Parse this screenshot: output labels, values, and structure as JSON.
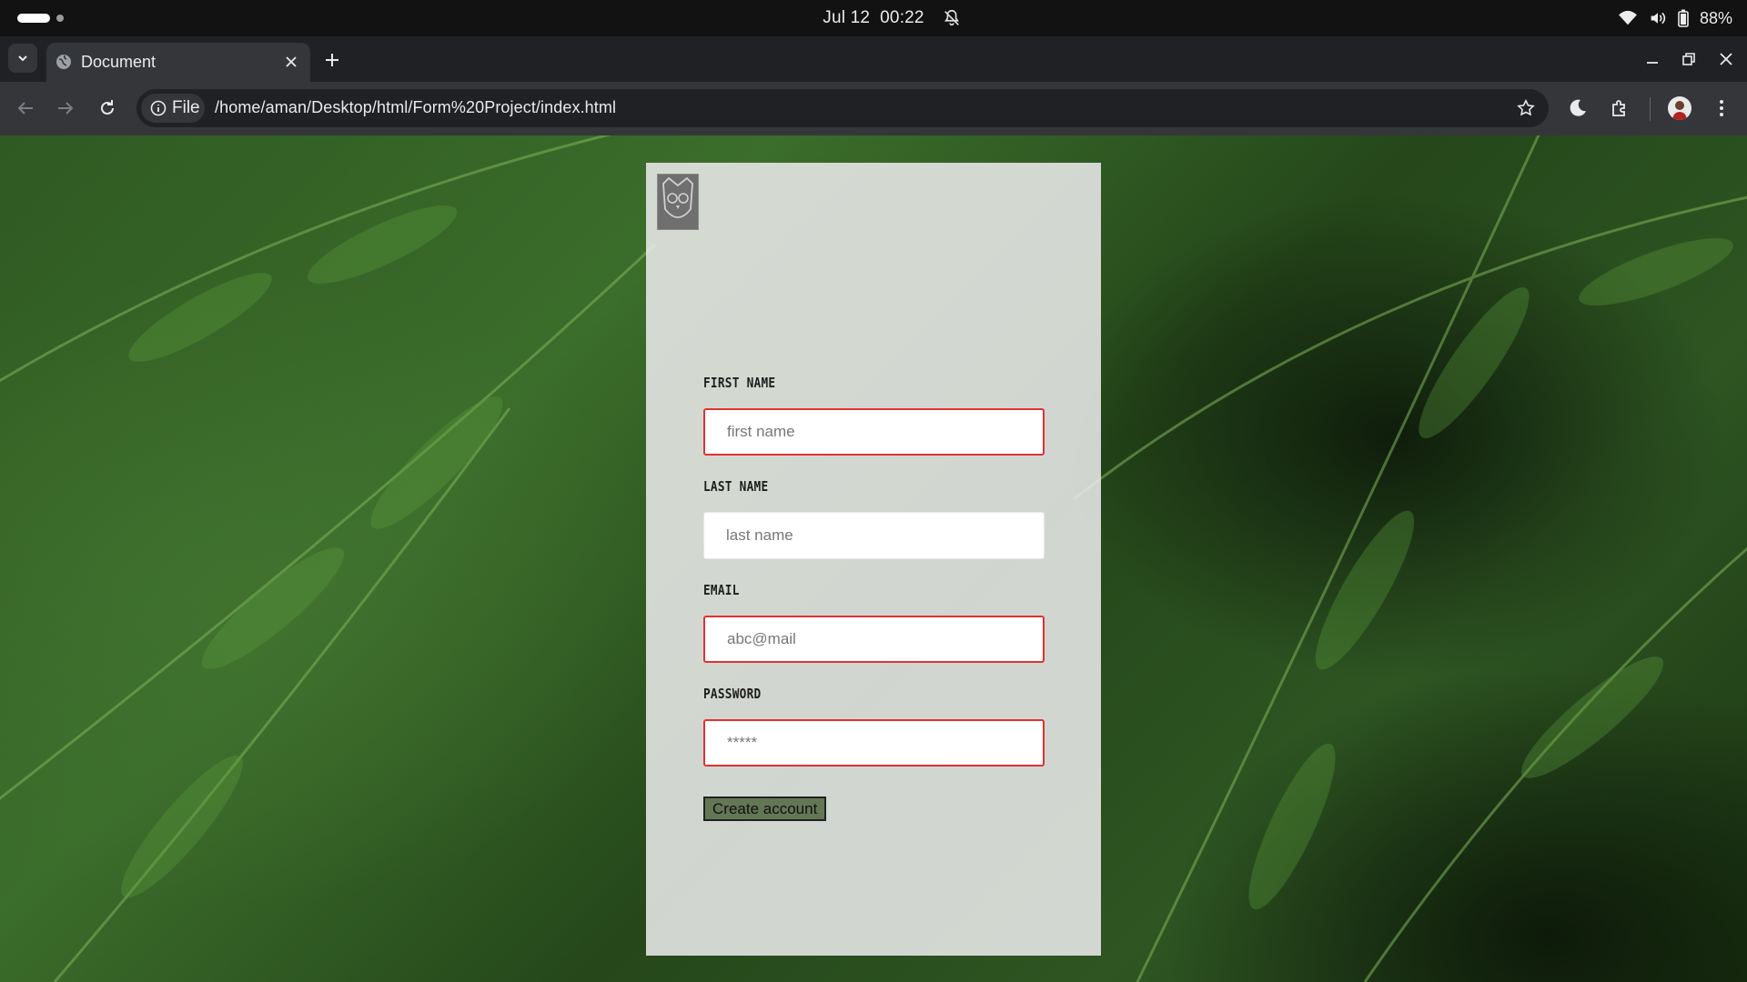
{
  "os": {
    "date": "Jul 12",
    "time": "00:22",
    "battery": "88%"
  },
  "browser": {
    "tab_title": "Document",
    "security_chip": "File",
    "url": "/home/aman/Desktop/html/Form%20Project/index.html"
  },
  "form": {
    "first_name": {
      "label": "FIRST NAME",
      "placeholder": "first name",
      "value": ""
    },
    "last_name": {
      "label": "LAST NAME",
      "placeholder": "last name",
      "value": ""
    },
    "email": {
      "label": "EMAIL",
      "placeholder": "abc@mail",
      "value": ""
    },
    "password": {
      "label": "PASSWORD",
      "placeholder": "*****",
      "value": ""
    },
    "submit_label": "Create account"
  },
  "colors": {
    "invalid_border": "#e23131",
    "button_bg": "#637655",
    "card_bg": "#e9e9e9"
  }
}
